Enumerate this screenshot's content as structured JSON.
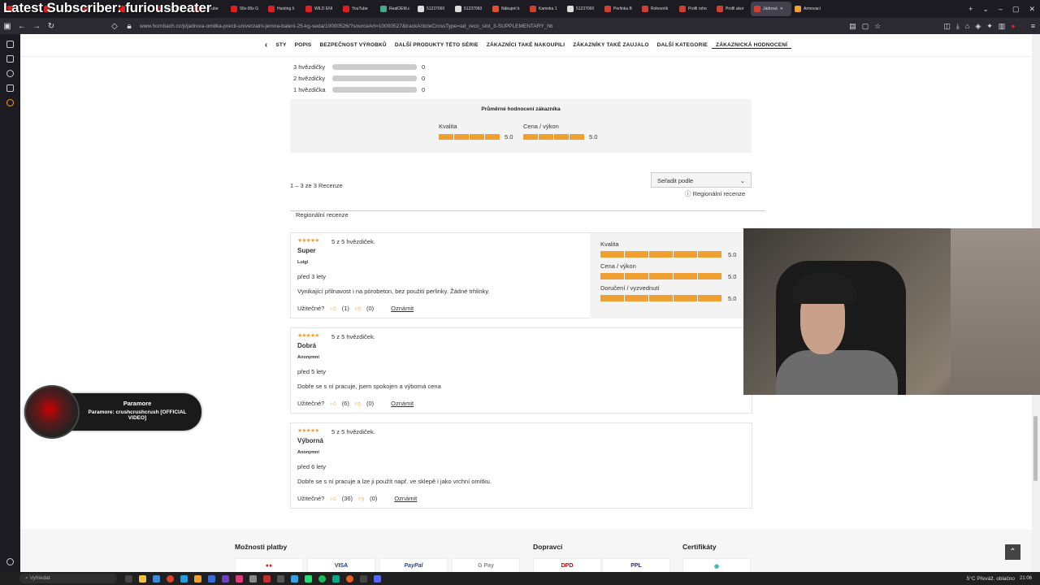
{
  "overlay_title": "Latest Subscriber: furiousbeater",
  "tabs": [
    {
      "label": "",
      "color": "#e02020"
    },
    {
      "label": "",
      "color": "#e02020"
    },
    {
      "label": "",
      "color": "#e02020"
    },
    {
      "label": "",
      "color": "#e02020"
    },
    {
      "label": "SESTOUP",
      "color": "#e02020"
    },
    {
      "label": "YouTube",
      "color": "#e02020"
    },
    {
      "label": "90s-00s G",
      "color": "#e02020"
    },
    {
      "label": "Hunting li",
      "color": "#e02020"
    },
    {
      "label": "WILD ENI",
      "color": "#e02020"
    },
    {
      "label": "YouTube",
      "color": "#e02020"
    },
    {
      "label": "RealOEM.c",
      "color": "#4a8"
    },
    {
      "label": "51237060",
      "color": "#ddd"
    },
    {
      "label": "51237060",
      "color": "#ddd"
    },
    {
      "label": "Nákupní k",
      "color": "#e05030"
    },
    {
      "label": "Kamoka 1",
      "color": "#d04030"
    },
    {
      "label": "51237060",
      "color": "#ddd"
    },
    {
      "label": "Perlinka B",
      "color": "#d04030"
    },
    {
      "label": "Rohovník",
      "color": "#d04030"
    },
    {
      "label": "Profil roho",
      "color": "#d04030"
    },
    {
      "label": "Profil ukor",
      "color": "#d04030"
    },
    {
      "label": "Jádrová",
      "color": "#d04030",
      "active": true
    },
    {
      "label": "Armovací",
      "color": "#f0a030"
    }
  ],
  "url": "www.hornbach.cz/p/jadrova-omitka-precit-univerzalni-jemna-baleni-25-kg-seda/10000526/?sourceArt=10000527&trackArticleCrossType=ad_reco_slot_3-SUPPLEMENTARY_hb",
  "nav": {
    "back": "‹",
    "items": [
      "STY",
      "POPIS",
      "BEZPEČNOST VÝROBKŮ",
      "DALŠÍ PRODUKTY TÉTO SÉRIE",
      "ZÁKAZNÍCI TAKÉ NAKOUPILI",
      "ZÁKAZNÍKY TAKÉ ZAUJALO",
      "DALŠÍ KATEGORIE",
      "ZÁKAZNICKÁ HODNOCENÍ"
    ]
  },
  "star_breakdown": [
    {
      "label": "3 hvězdičky",
      "count": "0"
    },
    {
      "label": "2 hvězdičky",
      "count": "0"
    },
    {
      "label": "1 hvězdička",
      "count": "0"
    }
  ],
  "average": {
    "title": "Průměrné hodnocení zákazníka",
    "quality_label": "Kvalita",
    "quality_value": "5.0",
    "price_label": "Cena / výkon",
    "price_value": "5.0"
  },
  "results_count": "1 – 3 ze 3 Recenze",
  "sort_label": "Seřadit podle",
  "regional_link": "Regionální recenze",
  "regional_label": "Regionální recenze",
  "reviews": [
    {
      "stars_label": "5 z 5 hvězdiček.",
      "title": "Super",
      "author": "Luigi",
      "age": "před 3 lety",
      "text": "Vynikající přilnavost i na pórobeton, bez použití perlinky. Žádné trhlinky.",
      "helpful": "Užitečné?",
      "up": "(1)",
      "down": "(0)",
      "report": "Oznámit",
      "side": [
        {
          "label": "Kvalita",
          "value": "5.0"
        },
        {
          "label": "Cena / výkon",
          "value": "5.0"
        },
        {
          "label": "Doručení / vyzvednutí",
          "value": "5.0"
        }
      ]
    },
    {
      "stars_label": "5 z 5 hvězdiček.",
      "title": "Dobrá",
      "author": "Anonymní",
      "age": "před 5 lety",
      "text": "Dobře se s ní pracuje, jsem spokojen a výborná cena",
      "helpful": "Užitečné?",
      "up": "(6)",
      "down": "(0)",
      "report": "Oznámit"
    },
    {
      "stars_label": "5 z 5 hvězdiček.",
      "title": "Výborná",
      "author": "Anonymní",
      "age": "před 6 lety",
      "text": "Dobře se s ní pracuje a lze ji použít např. ve sklepě i jako vrchní omítku.",
      "helpful": "Užitečné?",
      "up": "(36)",
      "down": "(0)",
      "report": "Oznámit"
    }
  ],
  "music": {
    "title": "Paramore",
    "subtitle": "Paramore: crushcrushcrush [OFFICIAL VIDEO]"
  },
  "footer": {
    "payment": "Možnosti platby",
    "shipping": "Dopravci",
    "certificates": "Certifikáty",
    "pay_logos": [
      "●●",
      "VISA",
      "PayPal",
      "G Pay"
    ],
    "ship_logos": [
      "DPD",
      "PPL"
    ]
  },
  "taskbar": {
    "search": "Vyhledat",
    "weather": "5°C  Převáž. oblačno",
    "clock": "21:06"
  }
}
